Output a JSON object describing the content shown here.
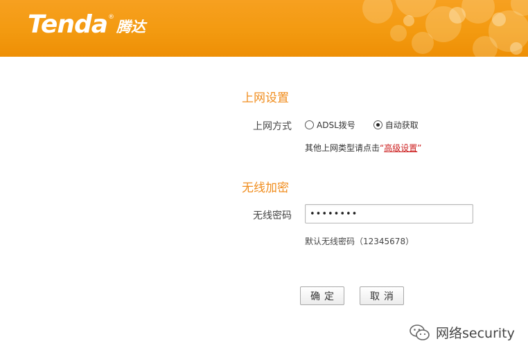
{
  "brand": {
    "logo_text": "Tenda",
    "logo_cn": "腾达",
    "reg_mark": "®",
    "color": "#f39a10"
  },
  "internet": {
    "title": "上网设置",
    "mode_label": "上网方式",
    "options": [
      "ADSL拨号",
      "自动获取"
    ],
    "selected_index": 1,
    "hint_prefix": "其他上网类型请点击",
    "hint_quote_open": "“",
    "hint_link": "高级设置",
    "hint_quote_close": "”"
  },
  "wireless": {
    "title": "无线加密",
    "password_label": "无线密码",
    "password_value": "••••••••",
    "default_hint": "默认无线密码（12345678）"
  },
  "actions": {
    "confirm": "确定",
    "cancel": "取消"
  },
  "watermark": {
    "text": "网络security",
    "icon": "wechat-icon"
  },
  "colors": {
    "accent": "#f08c1c",
    "link": "#cc1e1e"
  }
}
